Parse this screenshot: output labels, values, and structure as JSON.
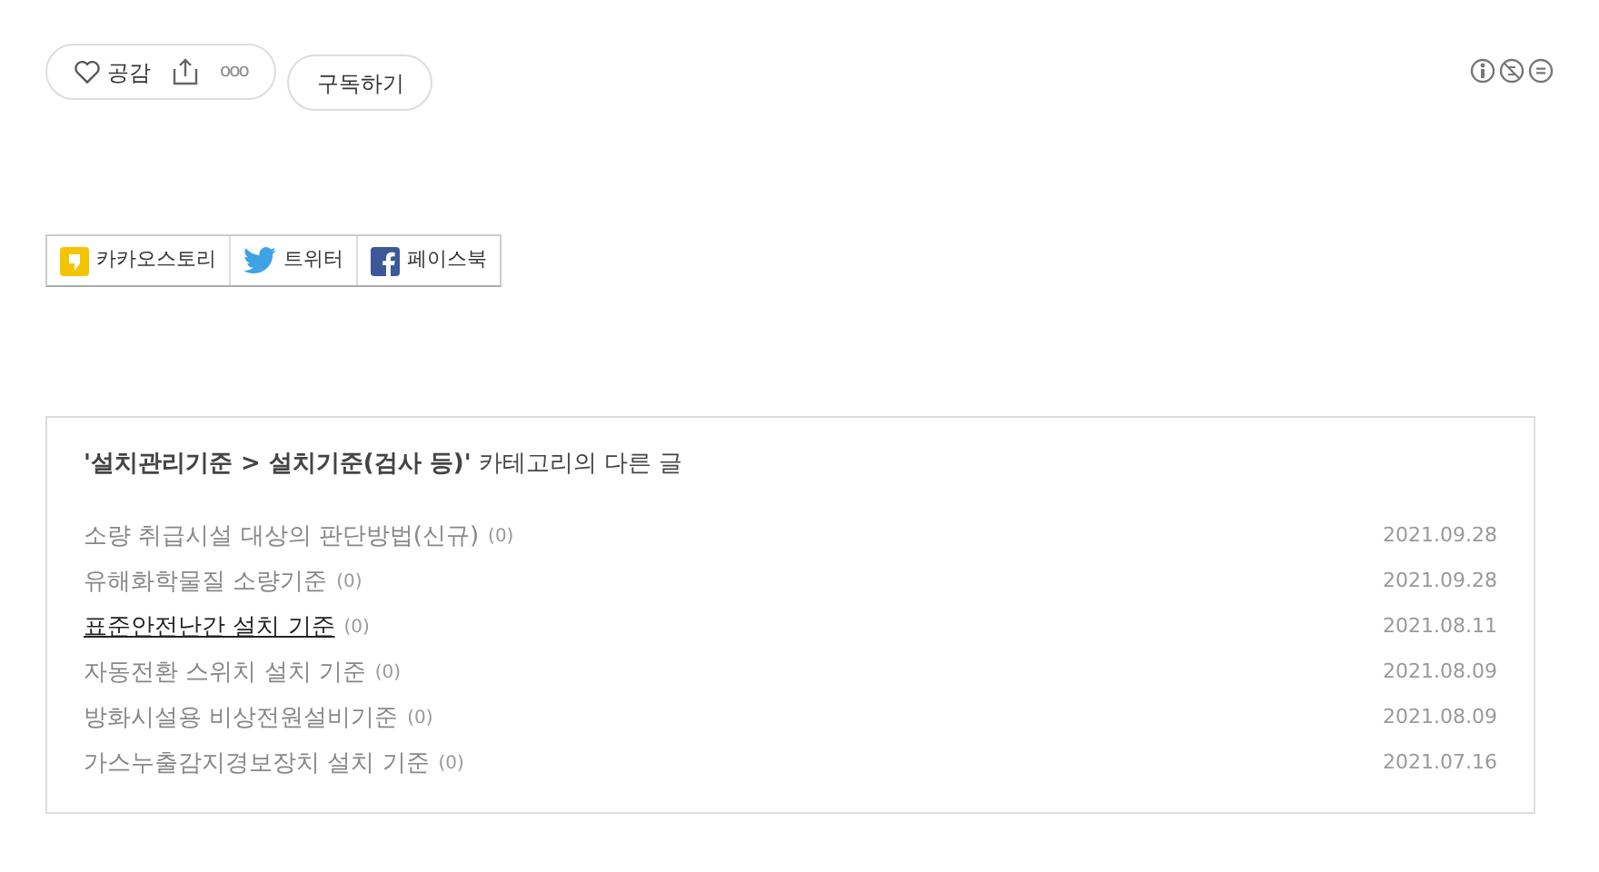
{
  "actions": {
    "like_label": "공감",
    "more": "ooo",
    "subscribe": "구독하기"
  },
  "share": [
    {
      "kind": "kakao",
      "label": "카카오스토리"
    },
    {
      "kind": "twitter",
      "label": "트위터"
    },
    {
      "kind": "facebook",
      "label": "페이스북"
    }
  ],
  "related": {
    "title": "**'설치관리기준 > 설치기준(검사 등)'** 카테고리의 다른 글",
    "posts": [
      {
        "title": "소량 취급시설 대상의 판단방법(신규)",
        "count": "(0)",
        "date": "2021.09.28",
        "selected": false
      },
      {
        "title": "유해화학물질 소량기준",
        "count": "(0)",
        "date": "2021.09.28",
        "selected": false
      },
      {
        "title": "표준안전난간 설치 기준",
        "count": "(0)",
        "date": "2021.08.11",
        "selected": true
      },
      {
        "title": "자동전환 스위치 설치 기준",
        "count": "(0)",
        "date": "2021.08.09",
        "selected": false
      },
      {
        "title": "방화시설용 비상전원설비기준",
        "count": "(0)",
        "date": "2021.08.09",
        "selected": false
      },
      {
        "title": "가스누출감지경보장치 설치 기준",
        "count": "(0)",
        "date": "2021.07.16",
        "selected": false
      }
    ]
  }
}
